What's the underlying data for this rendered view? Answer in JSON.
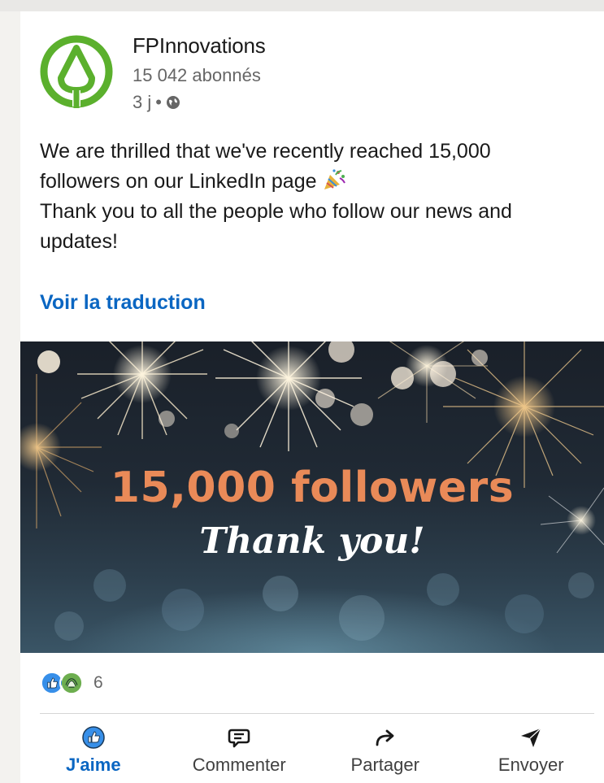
{
  "post": {
    "author": "FPInnovations",
    "followers": "15 042 abonnés",
    "time": "3 j",
    "separator": "•",
    "text_lines": [
      "We are thrilled that we've recently reached 15,000",
      "followers on our LinkedIn page",
      "Thank you to all the people who follow our news and",
      "updates!"
    ],
    "translate_link": "Voir la traduction",
    "image": {
      "headline": "15,000 followers",
      "subline": "Thank you!"
    },
    "reaction_count": "6"
  },
  "actions": [
    {
      "label": "J'aime",
      "icon": "like-icon",
      "active": true
    },
    {
      "label": "Commenter",
      "icon": "comment-icon",
      "active": false
    },
    {
      "label": "Partager",
      "icon": "share-icon",
      "active": false
    },
    {
      "label": "Envoyer",
      "icon": "send-icon",
      "active": false
    }
  ],
  "colors": {
    "accent": "#0a66c2",
    "brand_green": "#5bb02d",
    "headline_orange": "#e98a58"
  }
}
